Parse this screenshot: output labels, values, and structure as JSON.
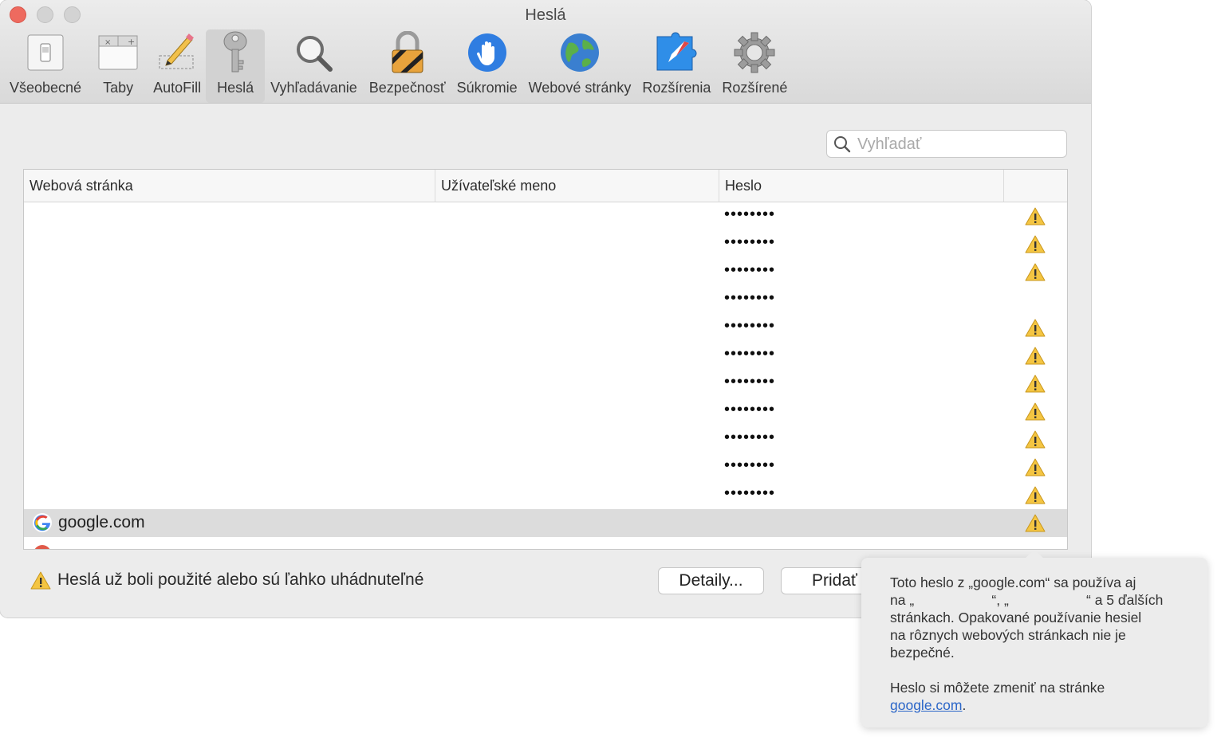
{
  "window": {
    "title": "Heslá"
  },
  "toolbar": {
    "items": [
      {
        "label": "Všeobecné",
        "icon": "switch-icon"
      },
      {
        "label": "Taby",
        "icon": "tabs-icon"
      },
      {
        "label": "AutoFill",
        "icon": "pencil-icon"
      },
      {
        "label": "Heslá",
        "icon": "key-icon",
        "active": true
      },
      {
        "label": "Vyhľadávanie",
        "icon": "magnifier-icon"
      },
      {
        "label": "Bezpečnosť",
        "icon": "lock-icon"
      },
      {
        "label": "Súkromie",
        "icon": "hand-icon"
      },
      {
        "label": "Webové stránky",
        "icon": "globe-icon"
      },
      {
        "label": "Rozšírenia",
        "icon": "puzzle-compass-icon"
      },
      {
        "label": "Rozšírené",
        "icon": "gear-icon"
      }
    ]
  },
  "search": {
    "placeholder": "Vyhľadať",
    "value": ""
  },
  "table": {
    "columns": [
      "Webová stránka",
      "Užívateľské meno",
      "Heslo"
    ],
    "rows": [
      {
        "site": "",
        "user": "",
        "password": "••••••••",
        "warning": true
      },
      {
        "site": "",
        "user": "",
        "password": "••••••••",
        "warning": true
      },
      {
        "site": "",
        "user": "",
        "password": "••••••••",
        "warning": true
      },
      {
        "site": "",
        "user": "",
        "password": "••••••••",
        "warning": false
      },
      {
        "site": "",
        "user": "",
        "password": "••••••••",
        "warning": true
      },
      {
        "site": "",
        "user": "",
        "password": "••••••••",
        "warning": true
      },
      {
        "site": "",
        "user": "",
        "password": "••••••••",
        "warning": true
      },
      {
        "site": "",
        "user": "",
        "password": "••••••••",
        "warning": true
      },
      {
        "site": "",
        "user": "",
        "password": "••••••••",
        "warning": true
      },
      {
        "site": "",
        "user": "",
        "password": "••••••••",
        "warning": true
      },
      {
        "site": "",
        "user": "",
        "password": "••••••••",
        "warning": true
      }
    ],
    "selected_row": {
      "site": "google.com",
      "warning": true
    }
  },
  "footer": {
    "warning_text": "Heslá už boli použité alebo sú ľahko uhádnuteľné",
    "details_button": "Detaily...",
    "add_button": "Pridať"
  },
  "popover": {
    "line1": "Toto heslo z „google.com“ sa používa aj",
    "line2": "na „                    “, „                    “ a 5 ďalších",
    "line3": "stránkach. Opakované používanie hesiel",
    "line4": "na rôznych webových stránkach nie je",
    "line5": "bezpečné.",
    "change_text": "Heslo si môžete zmeniť na stránke",
    "link": "google.com",
    "period": "."
  },
  "colors": {
    "close": "#ee6a5f",
    "warning": "#f4c542",
    "link": "#2b66c8",
    "selected_row": "#dcdcdc"
  }
}
